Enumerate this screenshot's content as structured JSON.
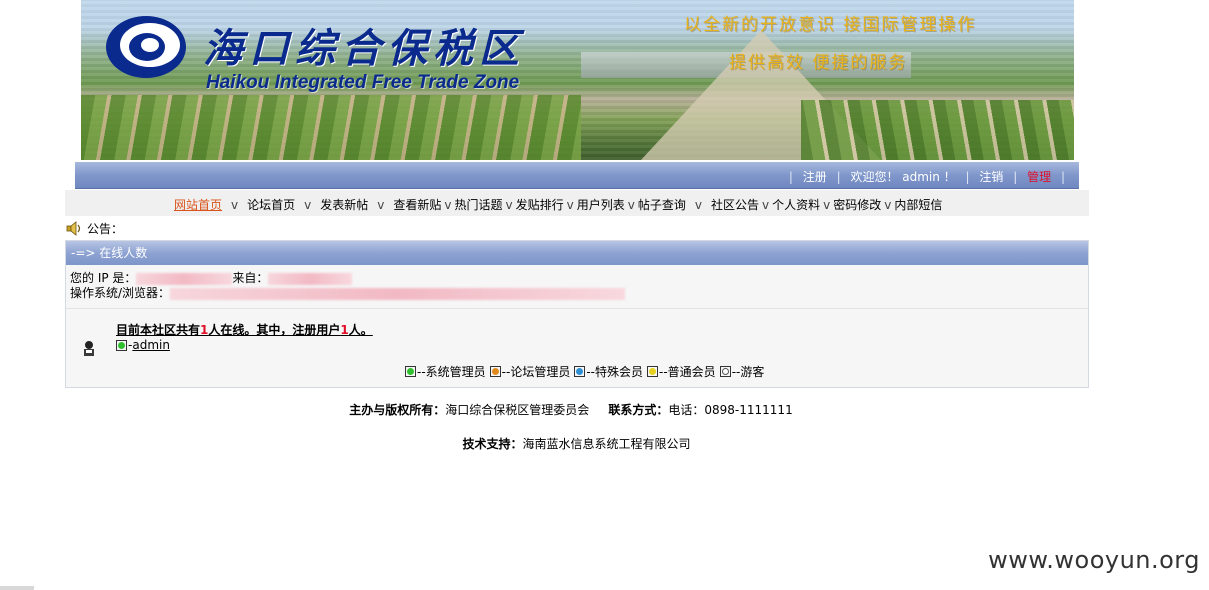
{
  "banner": {
    "title_cn": "海口综合保税区",
    "title_en": "Haikou Integrated Free Trade Zone",
    "slogan_line1": "以全新的开放意识  接国际管理操作",
    "slogan_line2": "提供高效 便捷的服务",
    "logo_color": "#0a2a8e"
  },
  "userbar": {
    "register": "注册",
    "welcome": "欢迎您！ admin ！",
    "logout": "注销",
    "manage": "管理"
  },
  "nav": {
    "items": [
      "网站首页",
      "论坛首页",
      "发表新帖",
      "查看新贴",
      "热门话题",
      "发贴排行",
      "用户列表",
      "帖子查询",
      "社区公告",
      "个人资料",
      "密码修改",
      "内部短信"
    ],
    "separator": "v"
  },
  "notice": {
    "label": "公告："
  },
  "online": {
    "header": "-=> 在线人数",
    "ip_label": "您的 IP 是：",
    "from_label": "来自：",
    "os_label": "操作系统/浏览器：",
    "summary_pre": "目前本社区共有",
    "total": "1",
    "summary_mid": "人在线。其中，注册用户",
    "registered": "1",
    "summary_post": "人。",
    "user_name": "admin",
    "user_prefix": "-",
    "legend": [
      {
        "label": "--系统管理员",
        "color": "#2fbf2f"
      },
      {
        "label": "--论坛管理员",
        "color": "#e08a1e"
      },
      {
        "label": "--特殊会员",
        "color": "#2f8fd0"
      },
      {
        "label": "--普通会员",
        "color": "#e6d21e"
      },
      {
        "label": "--游客",
        "color": "#ffffff"
      }
    ]
  },
  "footer": {
    "host_label": "主办与版权所有：",
    "host_value": "海口综合保税区管理委员会",
    "contact_label": "联系方式：",
    "contact_value": "电话：0898-1111111",
    "tech_label": "技术支持：",
    "tech_value": "海南蓝水信息系统工程有限公司"
  },
  "watermark": "www.wooyun.org"
}
